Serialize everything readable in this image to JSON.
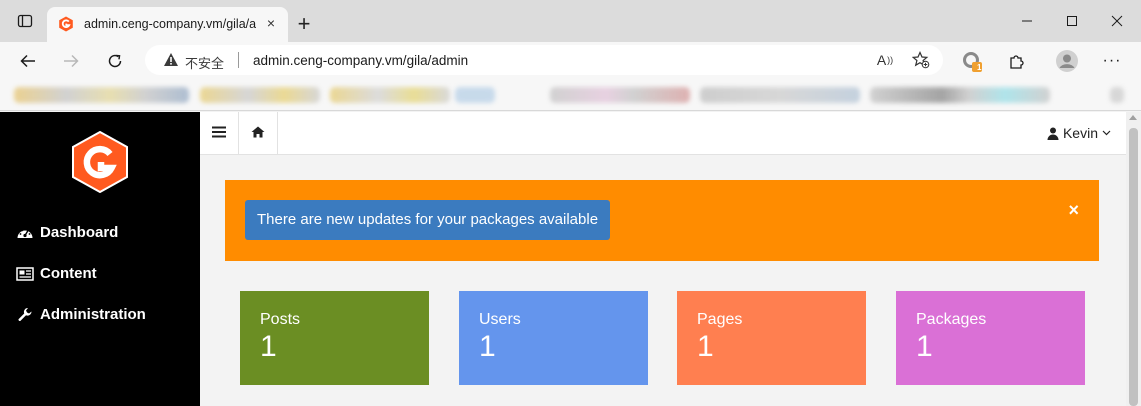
{
  "browser": {
    "tab_title": "admin.ceng-company.vm/gila/admin",
    "new_tab_glyph": "+",
    "close_glyph": "×",
    "not_secure_label": "不安全",
    "url": "admin.ceng-company.vm/gila/admin",
    "read_aloud_glyph": "A",
    "extension_badge": "1",
    "more_glyph": "···"
  },
  "sidebar": {
    "items": [
      {
        "label": "Dashboard",
        "icon": "dashboard-icon"
      },
      {
        "label": "Content",
        "icon": "content-icon"
      },
      {
        "label": "Administration",
        "icon": "wrench-icon"
      }
    ]
  },
  "topnav": {
    "user_name": "Kevin"
  },
  "alert": {
    "message": "There are new updates for your packages available",
    "close_glyph": "×",
    "color": "#ff8c00"
  },
  "cards": [
    {
      "label": "Posts",
      "value": "1",
      "color": "#6b8e23"
    },
    {
      "label": "Users",
      "value": "1",
      "color": "#6495ed"
    },
    {
      "label": "Pages",
      "value": "1",
      "color": "#ff7f50"
    },
    {
      "label": "Packages",
      "value": "1",
      "color": "#da70d6"
    }
  ]
}
